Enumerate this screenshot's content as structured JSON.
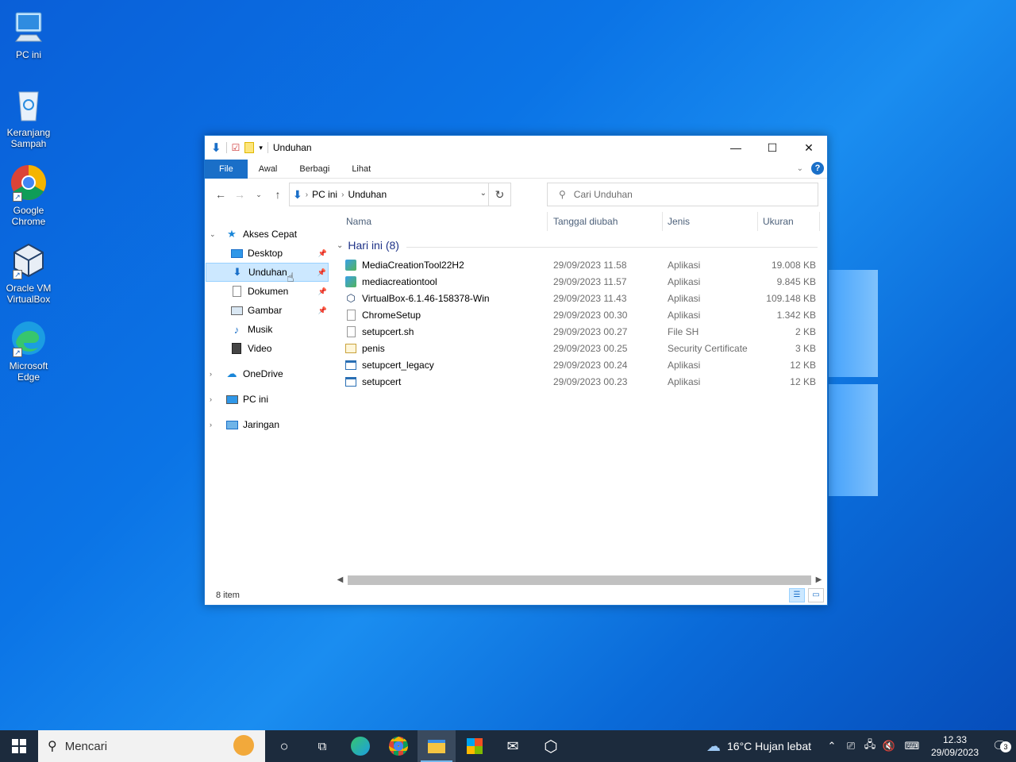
{
  "desktop": {
    "icons": [
      {
        "label": "PC ini"
      },
      {
        "label": "Keranjang Sampah"
      },
      {
        "label": "Google Chrome"
      },
      {
        "label": "Oracle VM VirtualBox"
      },
      {
        "label": "Microsoft Edge"
      }
    ]
  },
  "window": {
    "title": "Unduhan",
    "ribbon_tabs": [
      "File",
      "Awal",
      "Berbagi",
      "Lihat"
    ],
    "help": "?",
    "address": {
      "segments": [
        "PC ini",
        "Unduhan"
      ]
    },
    "search_placeholder": "Cari Unduhan",
    "nav": {
      "quick_access": "Akses Cepat",
      "items": [
        {
          "label": "Desktop",
          "pinned": true
        },
        {
          "label": "Unduhan",
          "pinned": true,
          "selected": true
        },
        {
          "label": "Dokumen",
          "pinned": true
        },
        {
          "label": "Gambar",
          "pinned": true
        },
        {
          "label": "Musik"
        },
        {
          "label": "Video"
        }
      ],
      "onedrive": "OneDrive",
      "this_pc": "PC ini",
      "network": "Jaringan"
    },
    "columns": {
      "name": "Nama",
      "date": "Tanggal diubah",
      "type": "Jenis",
      "size": "Ukuran"
    },
    "group": "Hari ini (8)",
    "files": [
      {
        "name": "MediaCreationTool22H2",
        "date": "29/09/2023 11.58",
        "type": "Aplikasi",
        "size": "19.008 KB",
        "icon": "setup-icon"
      },
      {
        "name": "mediacreationtool",
        "date": "29/09/2023 11.57",
        "type": "Aplikasi",
        "size": "9.845 KB",
        "icon": "setup-icon"
      },
      {
        "name": "VirtualBox-6.1.46-158378-Win",
        "date": "29/09/2023 11.43",
        "type": "Aplikasi",
        "size": "109.148 KB",
        "icon": "virtualbox-icon"
      },
      {
        "name": "ChromeSetup",
        "date": "29/09/2023 00.30",
        "type": "Aplikasi",
        "size": "1.342 KB",
        "icon": "blank-file-icon"
      },
      {
        "name": "setupcert.sh",
        "date": "29/09/2023 00.27",
        "type": "File SH",
        "size": "2 KB",
        "icon": "blank-file-icon"
      },
      {
        "name": "penis",
        "date": "29/09/2023 00.25",
        "type": "Security Certificate",
        "size": "3 KB",
        "icon": "certificate-icon"
      },
      {
        "name": "setupcert_legacy",
        "date": "29/09/2023 00.24",
        "type": "Aplikasi",
        "size": "12 KB",
        "icon": "app-window-icon"
      },
      {
        "name": "setupcert",
        "date": "29/09/2023 00.23",
        "type": "Aplikasi",
        "size": "12 KB",
        "icon": "app-window-icon"
      }
    ],
    "status": "8 item"
  },
  "taskbar": {
    "search_placeholder": "Mencari",
    "weather": "16°C  Hujan lebat",
    "time": "12.33",
    "date": "29/09/2023",
    "notifications": "3"
  },
  "colors": {
    "accent": "#1a6fc8",
    "selection": "#cce8ff",
    "taskbar": "#1c2b3d"
  }
}
